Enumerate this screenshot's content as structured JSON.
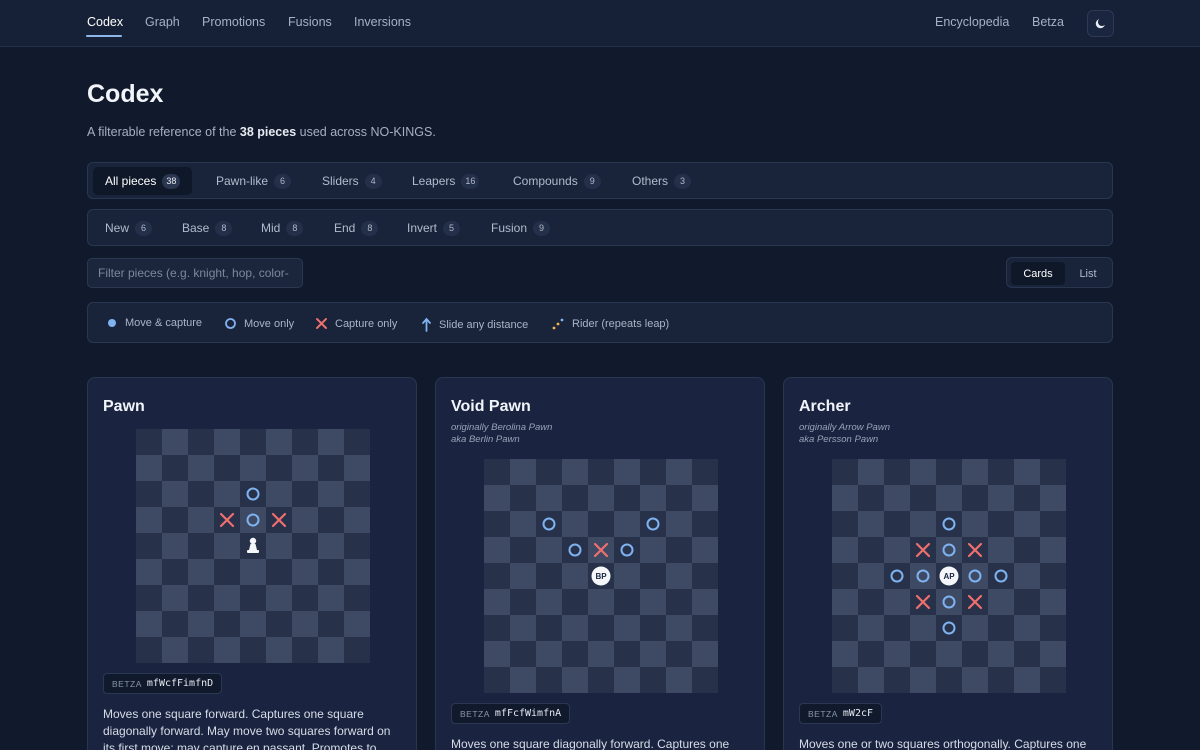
{
  "nav": {
    "left": [
      "Codex",
      "Graph",
      "Promotions",
      "Fusions",
      "Inversions"
    ],
    "right": [
      "Encyclopedia",
      "Betza"
    ],
    "theme_icon": "moon-icon"
  },
  "header": {
    "title": "Codex",
    "subtitle_pre": "A filterable reference of the ",
    "subtitle_bold": "38 pieces",
    "subtitle_post": " used across NO-KINGS."
  },
  "categories": [
    {
      "label": "All pieces",
      "count": "38"
    },
    {
      "label": "Pawn-like",
      "count": "6"
    },
    {
      "label": "Sliders",
      "count": "4"
    },
    {
      "label": "Leapers",
      "count": "16"
    },
    {
      "label": "Compounds",
      "count": "9"
    },
    {
      "label": "Others",
      "count": "3"
    }
  ],
  "stages": [
    {
      "label": "New",
      "count": "6"
    },
    {
      "label": "Base",
      "count": "8"
    },
    {
      "label": "Mid",
      "count": "8"
    },
    {
      "label": "End",
      "count": "8"
    },
    {
      "label": "Invert",
      "count": "5"
    },
    {
      "label": "Fusion",
      "count": "9"
    }
  ],
  "search": {
    "placeholder": "Filter pieces (e.g. knight, hop, color-"
  },
  "view_toggle": {
    "cards": "Cards",
    "list": "List"
  },
  "legend": [
    {
      "icon": "filled-dot-icon",
      "label": "Move & capture"
    },
    {
      "icon": "hollow-circle-icon",
      "label": "Move only"
    },
    {
      "icon": "x-mark-icon",
      "label": "Capture only"
    },
    {
      "icon": "arrow-up-icon",
      "label": "Slide any distance"
    },
    {
      "icon": "rider-dots-icon",
      "label": "Rider (repeats leap)"
    }
  ],
  "colors": {
    "accent": "#7fb2ef",
    "capture": "#ef6f6f",
    "rider": "#f2b84b",
    "dark_square": "#27324a",
    "light_square": "#3e4a64"
  },
  "cards": [
    {
      "title": "Pawn",
      "alt": [],
      "piece": {
        "icon": "pawn-icon",
        "label": ""
      },
      "moves": [
        [
          0,
          -2,
          "move"
        ],
        [
          0,
          -1,
          "move"
        ],
        [
          -1,
          -1,
          "capture"
        ],
        [
          1,
          -1,
          "capture"
        ]
      ],
      "betza_label": "BETZA",
      "betza": "mfWcfFimfnD",
      "description": "Moves one square forward. Captures one square diagonally forward. May move two squares forward on its first move; may capture en passant. Promotes to"
    },
    {
      "title": "Void Pawn",
      "alt": [
        "originally Berolina Pawn",
        "aka Berlin Pawn"
      ],
      "piece": {
        "icon": "",
        "label": "BP"
      },
      "moves": [
        [
          -2,
          -2,
          "move"
        ],
        [
          2,
          -2,
          "move"
        ],
        [
          -1,
          -1,
          "move"
        ],
        [
          1,
          -1,
          "move"
        ],
        [
          0,
          -1,
          "capture"
        ]
      ],
      "betza_label": "BETZA",
      "betza": "mfFcfWimfnA",
      "description": "Moves one square diagonally forward. Captures one"
    },
    {
      "title": "Archer",
      "alt": [
        "originally Arrow Pawn",
        "aka Persson Pawn"
      ],
      "piece": {
        "icon": "",
        "label": "AP"
      },
      "moves": [
        [
          0,
          -2,
          "move"
        ],
        [
          0,
          -1,
          "move"
        ],
        [
          0,
          1,
          "move"
        ],
        [
          0,
          2,
          "move"
        ],
        [
          -2,
          0,
          "move"
        ],
        [
          -1,
          0,
          "move"
        ],
        [
          1,
          0,
          "move"
        ],
        [
          2,
          0,
          "move"
        ],
        [
          -1,
          -1,
          "capture"
        ],
        [
          1,
          -1,
          "capture"
        ],
        [
          -1,
          1,
          "capture"
        ],
        [
          1,
          1,
          "capture"
        ]
      ],
      "betza_label": "BETZA",
      "betza": "mW2cF",
      "description": "Moves one or two squares orthogonally. Captures one"
    }
  ]
}
